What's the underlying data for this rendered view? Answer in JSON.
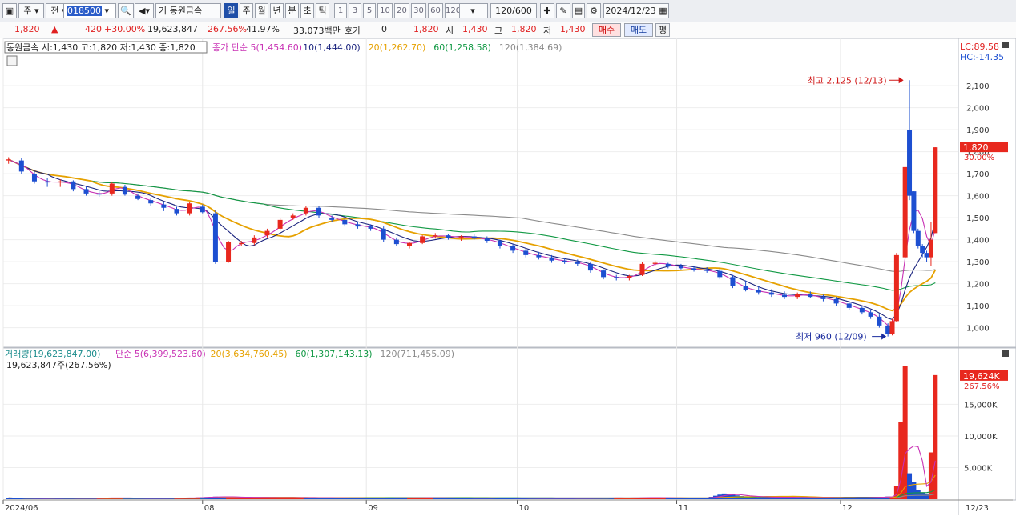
{
  "toolbar": {
    "chart_type": "주",
    "market": "전",
    "code": "018500",
    "stock_name": "동원금속",
    "name_prefix": "거",
    "periods": [
      "일",
      "주",
      "월",
      "년",
      "분",
      "초",
      "틱"
    ],
    "active_period": "일",
    "intervals": [
      "1",
      "3",
      "5",
      "10",
      "20",
      "30",
      "60",
      "120"
    ],
    "bar_count": "120/600",
    "date": "2024/12/23"
  },
  "quote": {
    "price": "1,820",
    "change": "420",
    "change_pct": "+30.00%",
    "volume": "19,623,847",
    "volume_ratio": "267.56%",
    "turnover": "41.97%",
    "trade_value": "33,073백만",
    "hoga_label": "호가",
    "hoga_value": "0",
    "hoga_price": "1,820",
    "open_label": "시",
    "open": "1,430",
    "high_label": "고",
    "high": "1,820",
    "low_label": "저",
    "low": "1,430",
    "buy_label": "매수",
    "sell_label": "매도",
    "avg_label": "평"
  },
  "colors": {
    "up": "#e8281e",
    "down": "#1d4fd1",
    "ma5": "#c831b4",
    "ma10": "#1a237e",
    "ma20": "#e6a100",
    "ma60": "#119944",
    "ma120": "#8a8a8a"
  },
  "chart_data": [
    {
      "type": "candlestick",
      "title": "동원금속 시:1,430 고:1,820 저:1,430 종:1,820",
      "legend": [
        "종가 단순 5(1,454.60)",
        "10(1,444.00)",
        "20(1,262.70)",
        "60(1,258.58)",
        "120(1,384.69)"
      ],
      "y_ticks": [
        "1,000",
        "1,100",
        "1,200",
        "1,300",
        "1,400",
        "1,500",
        "1,600",
        "1,700",
        "1,800",
        "1,900",
        "2,000",
        "2,100"
      ],
      "y_values": [
        1000,
        1100,
        1200,
        1300,
        1400,
        1500,
        1600,
        1700,
        1800,
        1900,
        2000,
        2100
      ],
      "ylim": [
        915,
        2235
      ],
      "x_ticks": [
        "2024/06",
        "08",
        "09",
        "10",
        "11",
        "12"
      ],
      "x_tick_bars": [
        0,
        45,
        83,
        118,
        155,
        193
      ],
      "last_date_label": "12/23",
      "lc_label": "LC:89.58",
      "hc_label": "HC:-14.35",
      "price_label": "1,820",
      "price_pct_label": "30.00%",
      "last_price": 1820,
      "high_annotation": "최고 2,125 (12/13)",
      "high_bar": 208,
      "high_price": 2125,
      "low_annotation": "최저 960 (12/09)",
      "low_bar": 204,
      "low_price": 960,
      "ohlc_note": "sampled candles: [bar, open, high, low, close]",
      "candles": [
        [
          0,
          1760,
          1775,
          1745,
          1765
        ],
        [
          3,
          1760,
          1770,
          1700,
          1710
        ],
        [
          6,
          1700,
          1710,
          1655,
          1665
        ],
        [
          9,
          1665,
          1680,
          1640,
          1660
        ],
        [
          12,
          1660,
          1675,
          1640,
          1665
        ],
        [
          15,
          1665,
          1670,
          1620,
          1630
        ],
        [
          18,
          1630,
          1645,
          1600,
          1610
        ],
        [
          21,
          1610,
          1620,
          1595,
          1605
        ],
        [
          24,
          1610,
          1660,
          1600,
          1655
        ],
        [
          27,
          1640,
          1650,
          1600,
          1605
        ],
        [
          30,
          1600,
          1610,
          1580,
          1585
        ],
        [
          33,
          1580,
          1590,
          1555,
          1565
        ],
        [
          36,
          1560,
          1570,
          1530,
          1545
        ],
        [
          39,
          1540,
          1550,
          1510,
          1520
        ],
        [
          42,
          1520,
          1570,
          1510,
          1565
        ],
        [
          45,
          1550,
          1560,
          1520,
          1525
        ],
        [
          48,
          1520,
          1535,
          1290,
          1300
        ],
        [
          51,
          1300,
          1395,
          1295,
          1390
        ],
        [
          54,
          1380,
          1395,
          1370,
          1385
        ],
        [
          57,
          1385,
          1420,
          1375,
          1410
        ],
        [
          60,
          1420,
          1450,
          1410,
          1440
        ],
        [
          63,
          1450,
          1500,
          1440,
          1490
        ],
        [
          66,
          1500,
          1520,
          1490,
          1510
        ],
        [
          69,
          1520,
          1555,
          1510,
          1545
        ],
        [
          72,
          1545,
          1555,
          1500,
          1510
        ],
        [
          75,
          1500,
          1510,
          1480,
          1490
        ],
        [
          78,
          1490,
          1500,
          1460,
          1470
        ],
        [
          81,
          1470,
          1480,
          1450,
          1460
        ],
        [
          84,
          1460,
          1470,
          1440,
          1450
        ],
        [
          87,
          1450,
          1460,
          1390,
          1400
        ],
        [
          90,
          1400,
          1410,
          1370,
          1380
        ],
        [
          93,
          1370,
          1390,
          1360,
          1385
        ],
        [
          96,
          1385,
          1420,
          1380,
          1415
        ],
        [
          99,
          1415,
          1430,
          1405,
          1420
        ],
        [
          102,
          1420,
          1425,
          1400,
          1410
        ],
        [
          105,
          1410,
          1420,
          1395,
          1415
        ],
        [
          108,
          1415,
          1425,
          1400,
          1405
        ],
        [
          111,
          1405,
          1415,
          1385,
          1395
        ],
        [
          114,
          1395,
          1400,
          1360,
          1370
        ],
        [
          117,
          1370,
          1380,
          1340,
          1350
        ],
        [
          120,
          1350,
          1360,
          1320,
          1330
        ],
        [
          123,
          1330,
          1345,
          1310,
          1320
        ],
        [
          126,
          1320,
          1330,
          1295,
          1305
        ],
        [
          129,
          1305,
          1315,
          1290,
          1300
        ],
        [
          132,
          1300,
          1310,
          1280,
          1290
        ],
        [
          135,
          1290,
          1300,
          1250,
          1260
        ],
        [
          138,
          1260,
          1265,
          1220,
          1230
        ],
        [
          141,
          1230,
          1240,
          1215,
          1225
        ],
        [
          144,
          1225,
          1240,
          1215,
          1235
        ],
        [
          147,
          1240,
          1300,
          1235,
          1290
        ],
        [
          150,
          1290,
          1305,
          1280,
          1295
        ],
        [
          153,
          1290,
          1295,
          1270,
          1280
        ],
        [
          156,
          1280,
          1290,
          1265,
          1270
        ],
        [
          159,
          1270,
          1280,
          1255,
          1262
        ],
        [
          162,
          1262,
          1275,
          1250,
          1258
        ],
        [
          165,
          1258,
          1270,
          1220,
          1230
        ],
        [
          168,
          1230,
          1240,
          1180,
          1190
        ],
        [
          171,
          1190,
          1215,
          1165,
          1170
        ],
        [
          174,
          1170,
          1190,
          1150,
          1160
        ],
        [
          177,
          1160,
          1175,
          1140,
          1150
        ],
        [
          180,
          1150,
          1165,
          1130,
          1140
        ],
        [
          183,
          1140,
          1160,
          1130,
          1155
        ],
        [
          186,
          1155,
          1165,
          1135,
          1140
        ],
        [
          189,
          1140,
          1150,
          1120,
          1130
        ],
        [
          192,
          1130,
          1140,
          1100,
          1110
        ],
        [
          195,
          1110,
          1120,
          1080,
          1090
        ],
        [
          198,
          1090,
          1100,
          1060,
          1070
        ],
        [
          200,
          1070,
          1080,
          1040,
          1050
        ],
        [
          202,
          1050,
          1060,
          1000,
          1010
        ],
        [
          204,
          1010,
          1020,
          960,
          970
        ],
        [
          205,
          970,
          1040,
          965,
          1030
        ],
        [
          206,
          1030,
          1340,
          1025,
          1330
        ],
        [
          208,
          1320,
          1730,
          1560,
          1730
        ],
        [
          209,
          1900,
          2125,
          1580,
          1600
        ],
        [
          210,
          1620,
          1620,
          1430,
          1440
        ],
        [
          211,
          1440,
          1450,
          1360,
          1370
        ],
        [
          212,
          1370,
          1380,
          1320,
          1340
        ],
        [
          213,
          1340,
          1350,
          1300,
          1320
        ],
        [
          214,
          1320,
          1480,
          1280,
          1400
        ],
        [
          215,
          1430,
          1820,
          1430,
          1820
        ]
      ]
    },
    {
      "type": "bar",
      "title": "거래량(19,623,847.00)",
      "legend": [
        "단순 5(6,399,523.60)",
        "20(3,634,760.45)",
        "60(1,307,143.13)",
        "120(711,455.09)"
      ],
      "subtitle": "19,623,847주(267.56%)",
      "y_ticks": [
        "5,000K",
        "10,000K",
        "15,000K"
      ],
      "y_values": [
        5000,
        10000,
        15000
      ],
      "ylim": [
        0,
        21000
      ],
      "volume_label": "19,624K",
      "volume_pct_label": "267.56%",
      "unit": "K shares",
      "volumes": [
        [
          0,
          200,
          "down"
        ],
        [
          6,
          150,
          "down"
        ],
        [
          12,
          180,
          "down"
        ],
        [
          18,
          150,
          "down"
        ],
        [
          24,
          220,
          "up"
        ],
        [
          30,
          160,
          "down"
        ],
        [
          36,
          170,
          "down"
        ],
        [
          42,
          210,
          "up"
        ],
        [
          48,
          400,
          "down"
        ],
        [
          54,
          300,
          "up"
        ],
        [
          60,
          260,
          "up"
        ],
        [
          66,
          240,
          "up"
        ],
        [
          72,
          230,
          "down"
        ],
        [
          78,
          200,
          "down"
        ],
        [
          84,
          190,
          "down"
        ],
        [
          90,
          200,
          "down"
        ],
        [
          96,
          230,
          "up"
        ],
        [
          102,
          190,
          "down"
        ],
        [
          108,
          180,
          "down"
        ],
        [
          114,
          190,
          "down"
        ],
        [
          120,
          170,
          "down"
        ],
        [
          126,
          160,
          "down"
        ],
        [
          132,
          160,
          "down"
        ],
        [
          138,
          200,
          "down"
        ],
        [
          144,
          190,
          "up"
        ],
        [
          147,
          260,
          "up"
        ],
        [
          150,
          230,
          "up"
        ],
        [
          156,
          180,
          "down"
        ],
        [
          162,
          200,
          "down"
        ],
        [
          166,
          900,
          "down"
        ],
        [
          168,
          700,
          "down"
        ],
        [
          170,
          500,
          "down"
        ],
        [
          174,
          350,
          "down"
        ],
        [
          180,
          300,
          "down"
        ],
        [
          186,
          250,
          "down"
        ],
        [
          192,
          220,
          "down"
        ],
        [
          198,
          260,
          "down"
        ],
        [
          202,
          320,
          "down"
        ],
        [
          204,
          420,
          "down"
        ],
        [
          205,
          400,
          "up"
        ],
        [
          206,
          2100,
          "up"
        ],
        [
          207,
          12200,
          "up"
        ],
        [
          208,
          21000,
          "up"
        ],
        [
          209,
          4100,
          "down"
        ],
        [
          210,
          2700,
          "down"
        ],
        [
          211,
          1400,
          "down"
        ],
        [
          212,
          1100,
          "down"
        ],
        [
          213,
          900,
          "down"
        ],
        [
          214,
          7400,
          "up"
        ],
        [
          215,
          19624,
          "up"
        ]
      ]
    }
  ]
}
